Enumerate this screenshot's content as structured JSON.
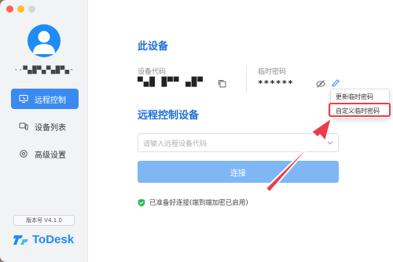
{
  "window": {
    "traffic_lights": [
      "close",
      "minimize",
      "zoom"
    ]
  },
  "sidebar": {
    "username": "··▀▄█▀▄▀▄█▀▄·",
    "items": [
      {
        "label": "远程控制",
        "icon": "monitor-icon",
        "active": true
      },
      {
        "label": "设备列表",
        "icon": "device-list-icon",
        "active": false
      },
      {
        "label": "高级设置",
        "icon": "gear-icon",
        "active": false
      }
    ],
    "version": "版本号 V4.1.0",
    "brand": "ToDesk"
  },
  "device": {
    "title": "此设备",
    "code_label": "设备代码",
    "code_value": "▀▄█ █▀▀ ▄█▀",
    "password_label": "临时密码",
    "password_value": "******"
  },
  "remote": {
    "title": "远程控制设备",
    "input_placeholder": "请输入远程设备代码",
    "connect_label": "连接",
    "status_text": "已准备好连接(端到端加密已启用)"
  },
  "dropdown_menu": {
    "items": [
      "更新临时密码",
      "自定义临时密码"
    ],
    "highlighted_index": 1
  },
  "colors": {
    "accent": "#1f8cf5",
    "nav_active": "#3a8bf0",
    "connect_button": "#7fb7f5",
    "annotation_red": "#ee3b49",
    "status_green": "#2eb85c"
  }
}
